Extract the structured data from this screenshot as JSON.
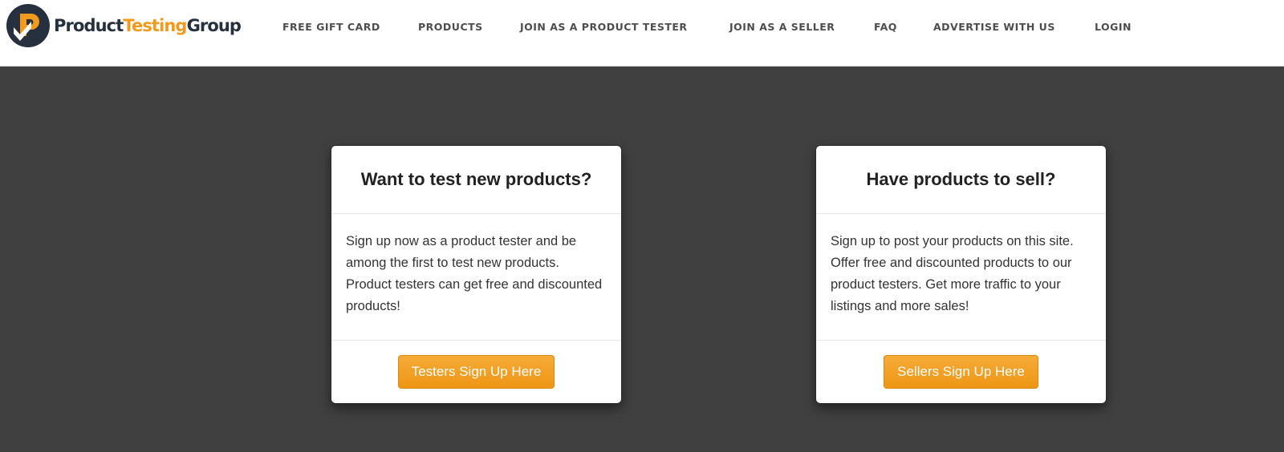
{
  "brand": {
    "name_part1": "Product",
    "name_part2": "Testing",
    "name_part3": "Group",
    "colors": {
      "dark": "#27303f",
      "orange": "#f29a1b"
    }
  },
  "nav": {
    "items": [
      {
        "label": "FREE GIFT CARD"
      },
      {
        "label": "PRODUCTS"
      },
      {
        "label": "JOIN AS A PRODUCT TESTER"
      },
      {
        "label": "JOIN AS A SELLER"
      },
      {
        "label": "FAQ"
      },
      {
        "label": "ADVERTISE WITH US"
      },
      {
        "label": "LOGIN"
      }
    ]
  },
  "cards": [
    {
      "title": "Want to test new products?",
      "text": "Sign up now as a product tester and be among the first to test new products. Product testers can get free and discounted products!",
      "button": "Testers Sign Up Here"
    },
    {
      "title": "Have products to sell?",
      "text": "Sign up to post your products on this site. Offer free and discounted products to our product testers. Get more traffic to your listings and more sales!",
      "button": "Sellers Sign Up Here"
    }
  ],
  "colors": {
    "background": "#404040",
    "accent": "#f29a1b",
    "card": "#ffffff"
  }
}
